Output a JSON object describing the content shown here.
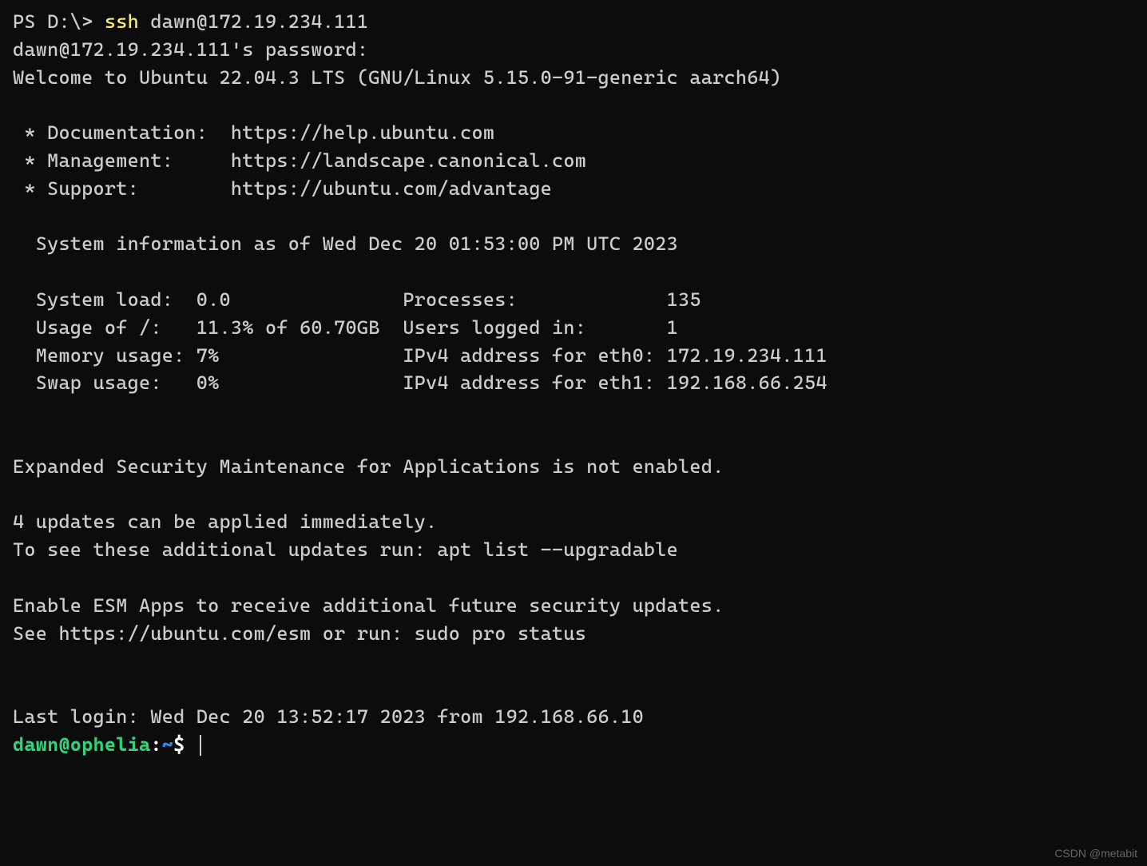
{
  "ps_prompt": "PS D:\\> ",
  "ssh_cmd": "ssh",
  "ssh_args": " dawn@172.19.234.111",
  "password_prompt": "dawn@172.19.234.111's password:",
  "welcome": "Welcome to Ubuntu 22.04.3 LTS (GNU/Linux 5.15.0-91-generic aarch64)",
  "links": {
    "doc_label": " * Documentation:  ",
    "doc_url": "https://help.ubuntu.com",
    "mgmt_label": " * Management:     ",
    "mgmt_url": "https://landscape.canonical.com",
    "support_label": " * Support:        ",
    "support_url": "https://ubuntu.com/advantage"
  },
  "sysinfo_header": "  System information as of Wed Dec 20 01:53:00 PM UTC 2023",
  "stats": {
    "row1": "  System load:  0.0               Processes:             135",
    "row2": "  Usage of /:   11.3% of 60.70GB  Users logged in:       1",
    "row3": "  Memory usage: 7%                IPv4 address for eth0: 172.19.234.111",
    "row4": "  Swap usage:   0%                IPv4 address for eth1: 192.168.66.254"
  },
  "esm_line": "Expanded Security Maintenance for Applications is not enabled.",
  "updates_line1": "4 updates can be applied immediately.",
  "updates_line2": "To see these additional updates run: apt list --upgradable",
  "esm_enable1": "Enable ESM Apps to receive additional future security updates.",
  "esm_enable2": "See https://ubuntu.com/esm or run: sudo pro status",
  "last_login": "Last login: Wed Dec 20 13:52:17 2023 from 192.168.66.10",
  "bash_prompt": {
    "userhost": "dawn@ophelia",
    "colon": ":",
    "path": "~",
    "dollar": "$ "
  },
  "watermark": "CSDN @metabit"
}
